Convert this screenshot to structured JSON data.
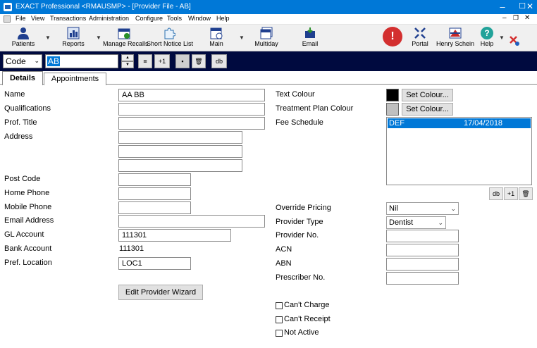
{
  "window": {
    "title": "EXACT Professional <RMAUSMP> - [Provider File - AB]",
    "controls": [
      "–",
      "☐",
      "✕"
    ]
  },
  "menu": [
    "File",
    "View",
    "Transactions",
    "Administration",
    "Configure",
    "Tools",
    "Window",
    "Help"
  ],
  "toolbar": {
    "patients": "Patients",
    "reports": "Reports",
    "manage_recalls": "Manage Recalls",
    "short_notice_list": "Short Notice List",
    "main": "Main",
    "multiday": "Multiday",
    "email": "Email",
    "portal": "Portal",
    "henry_schein": "Henry Schein",
    "help": "Help"
  },
  "navbar": {
    "field_select": "Code",
    "search_value": "AB",
    "plus_one": "+1",
    "db": "db"
  },
  "tabs": [
    "Details",
    "Appointments"
  ],
  "form": {
    "name_label": "Name",
    "name_value": "AA BB",
    "qualifications_label": "Qualifications",
    "prof_title_label": "Prof. Title",
    "address_label": "Address",
    "post_code_label": "Post Code",
    "home_phone_label": "Home Phone",
    "mobile_phone_label": "Mobile Phone",
    "email_label": "Email Address",
    "gl_account_label": "GL Account",
    "gl_account_value": "111301",
    "bank_account_label": "Bank Account",
    "bank_account_value": "111301",
    "pref_location_label": "Pref. Location",
    "pref_location_value": "LOC1",
    "wizard_button": "Edit Provider Wizard",
    "text_colour_label": "Text Colour",
    "treatment_plan_colour_label": "Treatment Plan Colour",
    "set_colour_button": "Set Colour...",
    "text_colour": "#000000",
    "treatment_plan_colour": "#c0c0c0",
    "fee_schedule_label": "Fee Schedule",
    "fee_schedule_rows": [
      {
        "code": "DEF",
        "date": "17/04/2018"
      }
    ],
    "fee_plus_one": "+1",
    "fee_db": "db",
    "override_pricing_label": "Override Pricing",
    "override_pricing_value": "Nil",
    "provider_type_label": "Provider Type",
    "provider_type_value": "Dentist",
    "provider_no_label": "Provider No.",
    "acn_label": "ACN",
    "abn_label": "ABN",
    "prescriber_no_label": "Prescriber No.",
    "cant_charge_label": "Can't Charge",
    "cant_receipt_label": "Can't Receipt",
    "not_active_label": "Not Active"
  },
  "colors": {
    "titlebar": "#0078d7",
    "navbar": "#000a3f",
    "selection": "#0078d7"
  }
}
